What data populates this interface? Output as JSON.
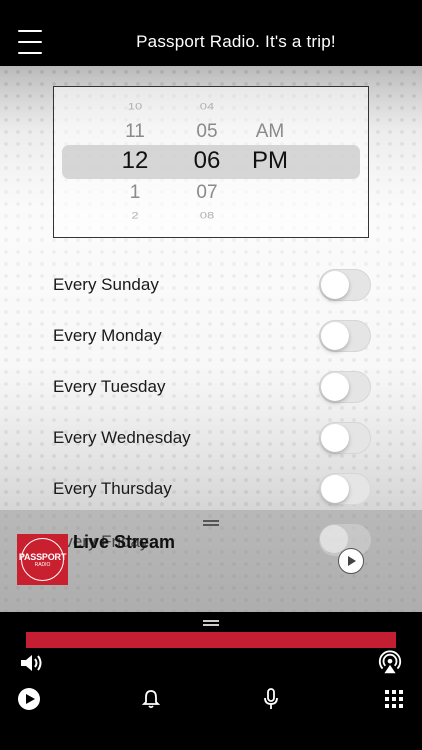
{
  "header": {
    "title": "Passport Radio. It's a trip!",
    "menu_icon": "menu-icon"
  },
  "time_picker": {
    "hours": [
      "10",
      "11",
      "12",
      "1",
      "2"
    ],
    "minutes": [
      "04",
      "05",
      "06",
      "07",
      "08"
    ],
    "period": [
      "AM",
      "PM"
    ],
    "selected": {
      "hour": "12",
      "minute": "06",
      "period": "PM"
    }
  },
  "days": [
    {
      "label": "Every Sunday",
      "enabled": false
    },
    {
      "label": "Every Monday",
      "enabled": false
    },
    {
      "label": "Every Tuesday",
      "enabled": false
    },
    {
      "label": "Every Wednesday",
      "enabled": false
    },
    {
      "label": "Every Thursday",
      "enabled": false
    },
    {
      "label": "Every Friday",
      "enabled": false
    }
  ],
  "player": {
    "title": "Live Stream",
    "artwork_text": "PASSPORT",
    "artwork_sub": "RADIO"
  },
  "bottom_bar": {
    "icons": [
      "volume-icon",
      "airplay-icon",
      "play-icon",
      "bell-icon",
      "microphone-icon",
      "grid-icon"
    ]
  },
  "colors": {
    "accent": "#c31e32",
    "header_bg": "#000000"
  }
}
